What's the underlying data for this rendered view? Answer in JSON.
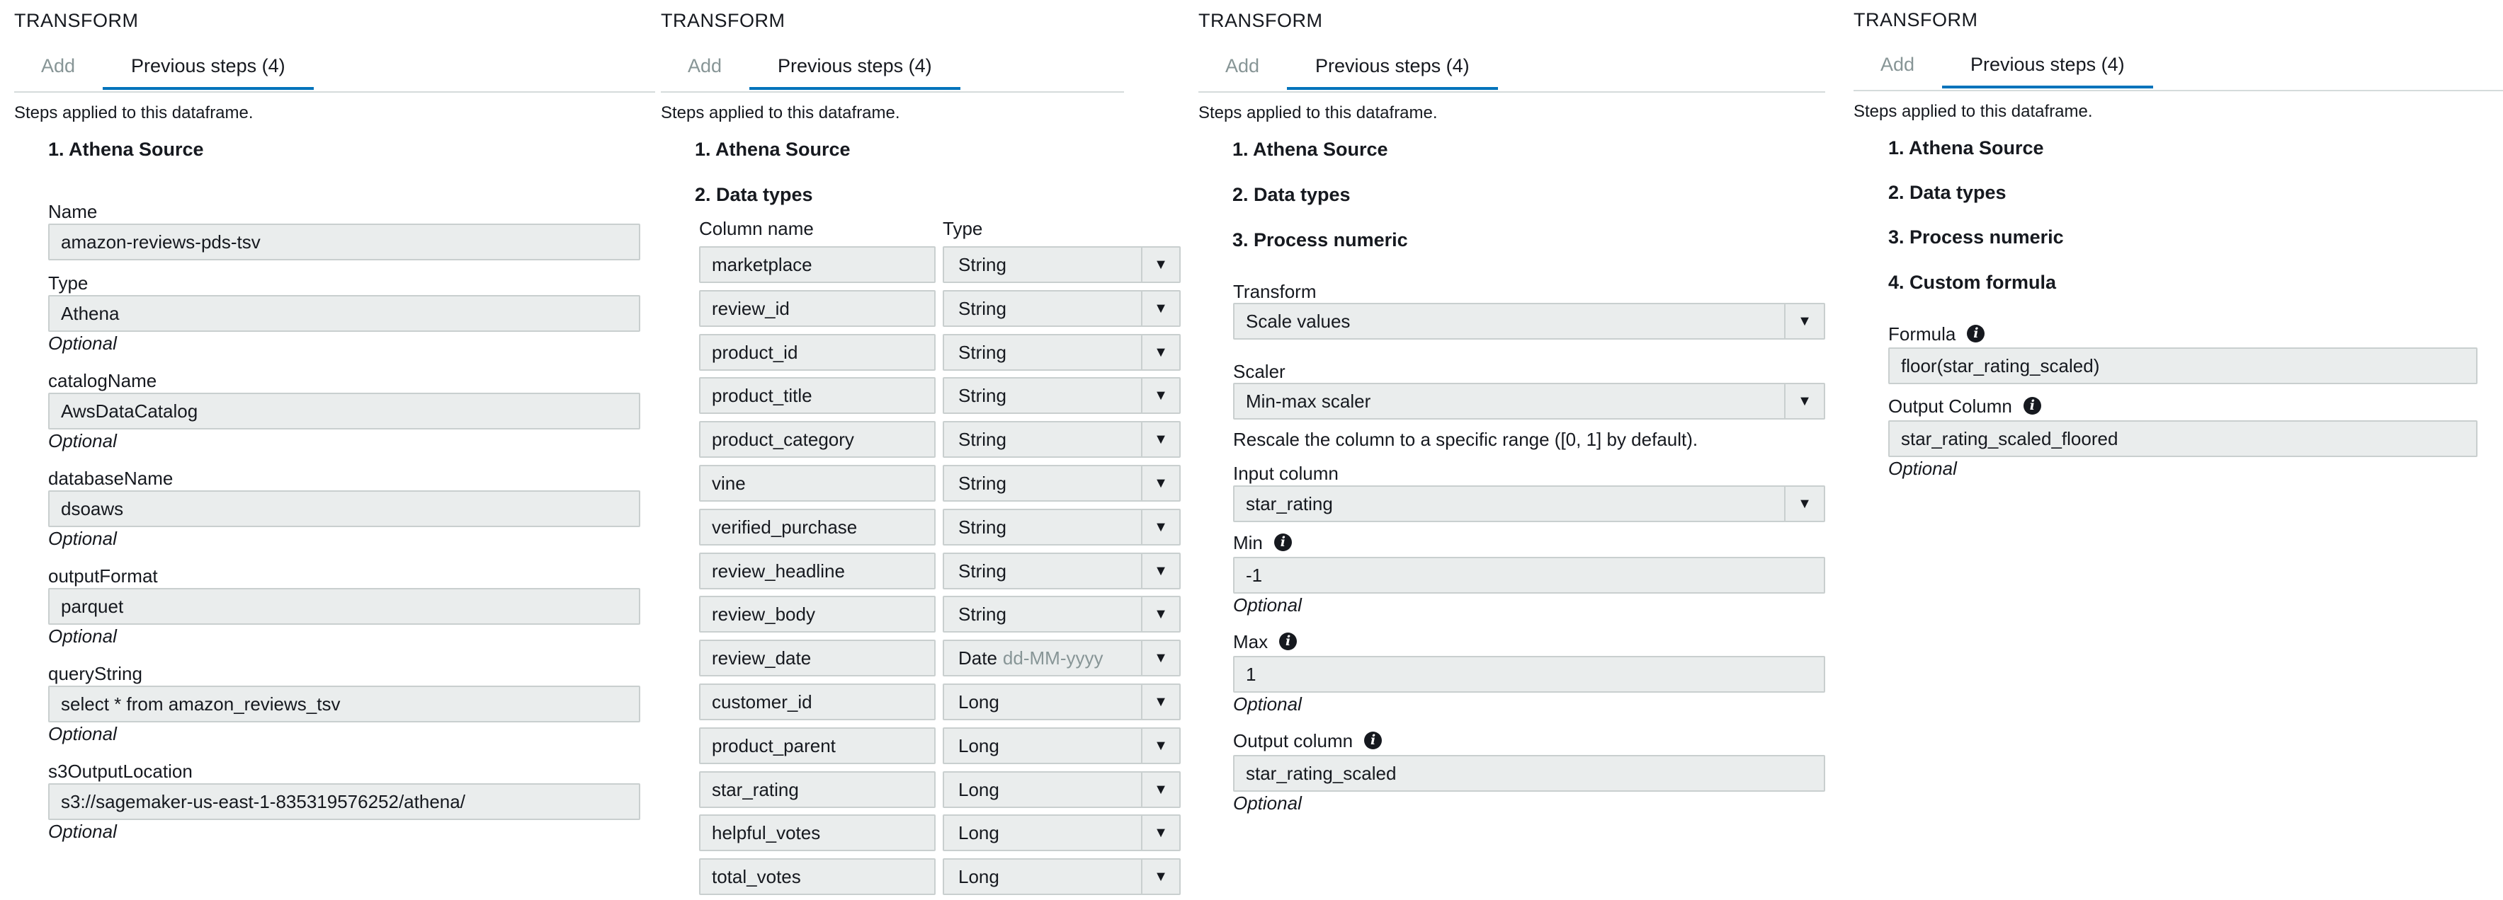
{
  "panel1": {
    "header": "TRANSFORM",
    "tab_add": "Add",
    "tab_previous": "Previous steps (4)",
    "intro": "Steps applied to this dataframe.",
    "step1": "1. Athena Source",
    "fields": [
      {
        "label": "Name",
        "value": "amazon-reviews-pds-tsv",
        "optional": ""
      },
      {
        "label": "Type",
        "value": "Athena",
        "optional": "Optional"
      },
      {
        "label": "catalogName",
        "value": "AwsDataCatalog",
        "optional": "Optional"
      },
      {
        "label": "databaseName",
        "value": "dsoaws",
        "optional": "Optional"
      },
      {
        "label": "outputFormat",
        "value": "parquet",
        "optional": "Optional"
      },
      {
        "label": "queryString",
        "value": "select * from amazon_reviews_tsv",
        "optional": "Optional"
      },
      {
        "label": "s3OutputLocation",
        "value": "s3://sagemaker-us-east-1-835319576252/athena/",
        "optional": "Optional"
      }
    ]
  },
  "panel2": {
    "header": "TRANSFORM",
    "tab_add": "Add",
    "tab_previous": "Previous steps (4)",
    "intro": "Steps applied to this dataframe.",
    "step1": "1. Athena Source",
    "step2": "2. Data types",
    "col_name_header": "Column name",
    "col_type_header": "Type",
    "rows": [
      {
        "name": "marketplace",
        "type": "String",
        "format": ""
      },
      {
        "name": "review_id",
        "type": "String",
        "format": ""
      },
      {
        "name": "product_id",
        "type": "String",
        "format": ""
      },
      {
        "name": "product_title",
        "type": "String",
        "format": ""
      },
      {
        "name": "product_category",
        "type": "String",
        "format": ""
      },
      {
        "name": "vine",
        "type": "String",
        "format": ""
      },
      {
        "name": "verified_purchase",
        "type": "String",
        "format": ""
      },
      {
        "name": "review_headline",
        "type": "String",
        "format": ""
      },
      {
        "name": "review_body",
        "type": "String",
        "format": ""
      },
      {
        "name": "review_date",
        "type": "Date",
        "format": "dd-MM-yyyy"
      },
      {
        "name": "customer_id",
        "type": "Long",
        "format": ""
      },
      {
        "name": "product_parent",
        "type": "Long",
        "format": ""
      },
      {
        "name": "star_rating",
        "type": "Long",
        "format": ""
      },
      {
        "name": "helpful_votes",
        "type": "Long",
        "format": ""
      },
      {
        "name": "total_votes",
        "type": "Long",
        "format": ""
      }
    ]
  },
  "panel3": {
    "header": "TRANSFORM",
    "tab_add": "Add",
    "tab_previous": "Previous steps (4)",
    "intro": "Steps applied to this dataframe.",
    "step1": "1. Athena Source",
    "step2": "2. Data types",
    "step3": "3. Process numeric",
    "transform_label": "Transform",
    "transform_value": "Scale values",
    "scaler_label": "Scaler",
    "scaler_value": "Min-max scaler",
    "scaler_help": "Rescale the column to a specific range ([0, 1] by default).",
    "input_label": "Input column",
    "input_value": "star_rating",
    "min_label": "Min",
    "min_value": "-1",
    "min_optional": "Optional",
    "max_label": "Max",
    "max_value": "1",
    "max_optional": "Optional",
    "output_label": "Output column",
    "output_value": "star_rating_scaled",
    "output_optional": "Optional"
  },
  "panel4": {
    "header": "TRANSFORM",
    "tab_add": "Add",
    "tab_previous": "Previous steps (4)",
    "intro": "Steps applied to this dataframe.",
    "step1": "1. Athena Source",
    "step2": "2. Data types",
    "step3": "3. Process numeric",
    "step4": "4. Custom formula",
    "formula_label": "Formula",
    "formula_value": "floor(star_rating_scaled)",
    "output_label": "Output Column",
    "output_value": "star_rating_scaled_floored",
    "output_optional": "Optional"
  },
  "icons": {
    "info": "info-icon",
    "dropdown": "chevron-down-icon"
  },
  "colors": {
    "tab_active_underline": "#0073bb",
    "field_background": "#eaeded",
    "muted_text": "#879596"
  }
}
